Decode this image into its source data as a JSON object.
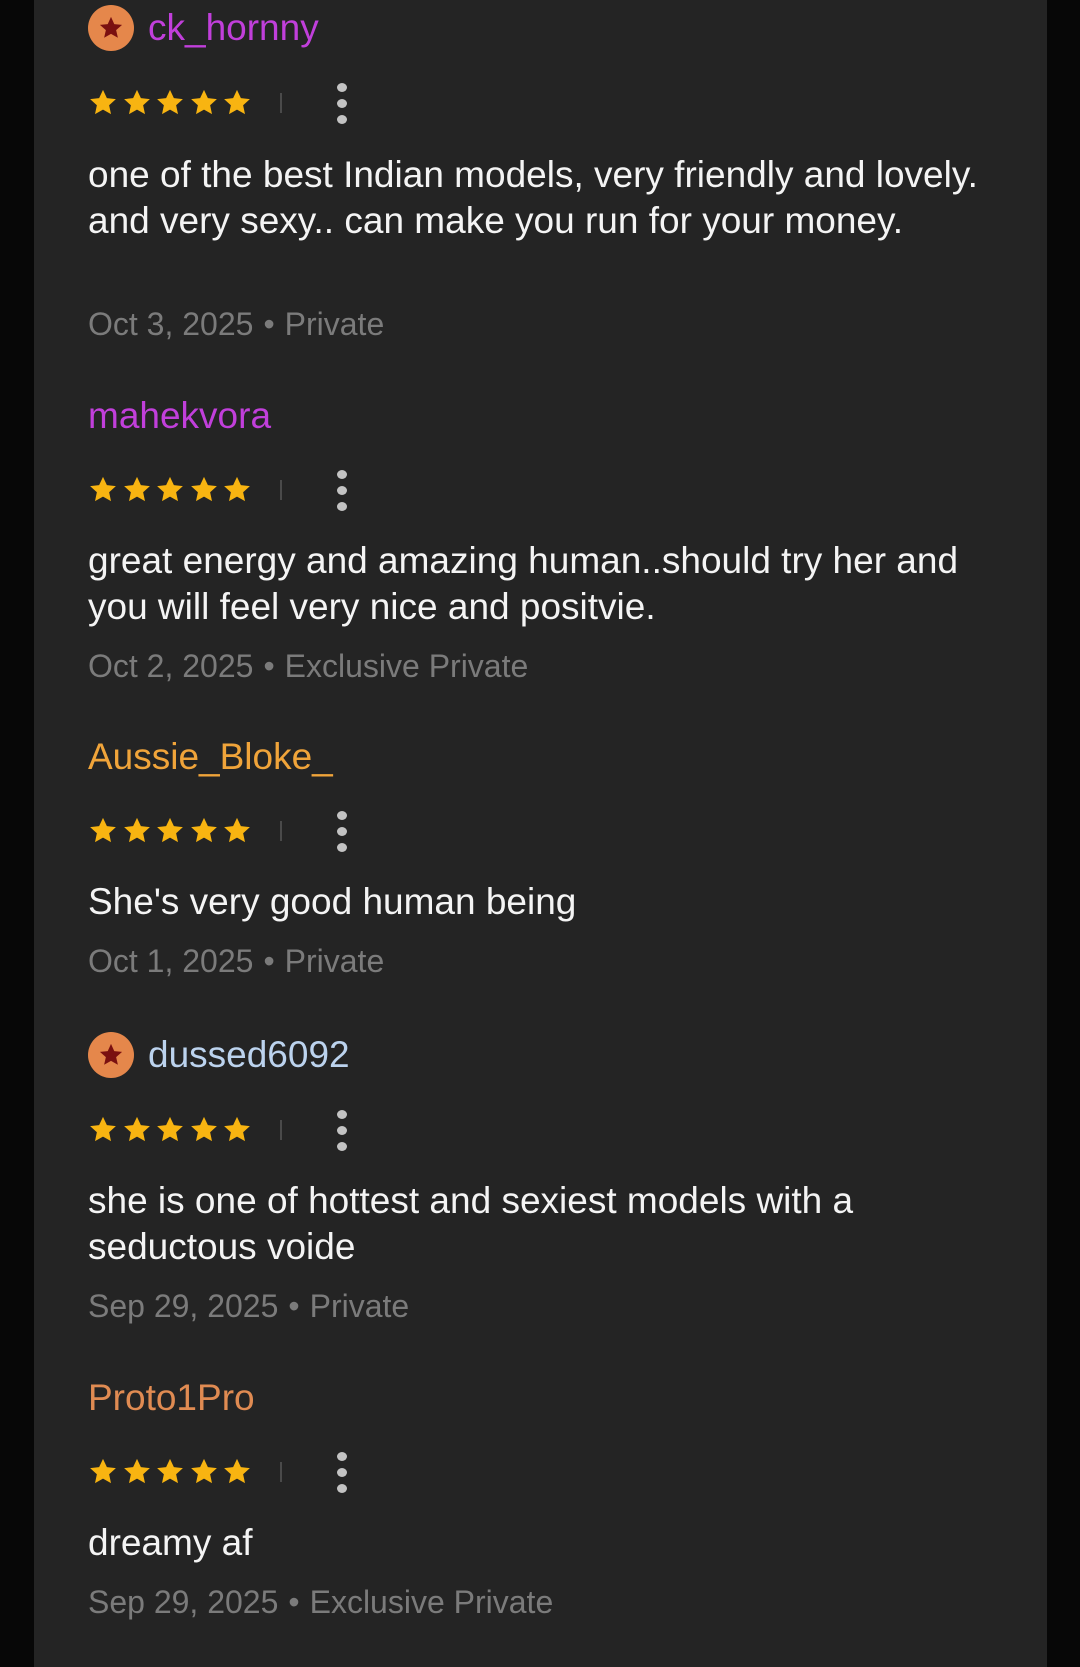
{
  "colors": {
    "background_outer": "#070707",
    "panel": "#242424",
    "star": "#f8b411",
    "badge": "#e5874b",
    "badge_star": "#7a1010",
    "text": "#f4f4f4",
    "meta": "#7b7b7b"
  },
  "reviews": [
    {
      "username": "ck_hornny",
      "username_color": "#c13fdb",
      "has_badge": true,
      "badge_icon": "star-badge-icon",
      "rating": 5,
      "text": "one of the best Indian models, very friendly and lovely. and very sexy.. can make you run for your money.",
      "date": "Oct 3, 2025",
      "separator": "•",
      "type": "Private"
    },
    {
      "username": "mahekvora",
      "username_color": "#c13fdb",
      "has_badge": false,
      "rating": 5,
      "text": "great energy and amazing human..should try her and you will feel very nice and positvie.",
      "date": "Oct 2, 2025",
      "separator": "•",
      "type": "Exclusive Private"
    },
    {
      "username": "Aussie_Bloke_",
      "username_color": "#f0a43a",
      "has_badge": false,
      "rating": 5,
      "text": "She's very good human being",
      "date": "Oct 1, 2025",
      "separator": "•",
      "type": "Private"
    },
    {
      "username": "dussed6092",
      "username_color": "#bcd3ee",
      "has_badge": true,
      "badge_icon": "star-badge-icon",
      "rating": 5,
      "text": "she is one of hottest and sexiest models with a seductous voide",
      "date": "Sep 29, 2025",
      "separator": "•",
      "type": "Private"
    },
    {
      "username": "Proto1Pro",
      "username_color": "#e08b52",
      "has_badge": false,
      "rating": 5,
      "text": "dreamy af",
      "date": "Sep 29, 2025",
      "separator": "•",
      "type": "Exclusive Private"
    }
  ]
}
